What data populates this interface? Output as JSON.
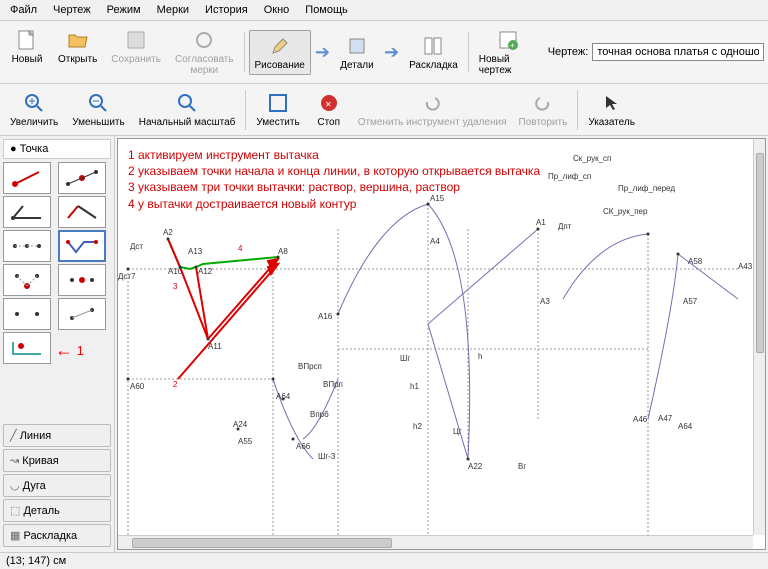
{
  "menu": [
    "Файл",
    "Чертеж",
    "Режим",
    "Мерки",
    "История",
    "Окно",
    "Помощь"
  ],
  "toolbar1": {
    "new": "Новый",
    "open": "Открыть",
    "save": "Сохранить",
    "sync": "Согласовать\nмерки",
    "drawing": "Рисование",
    "details": "Детали",
    "layout": "Раскладка",
    "newdraw": "Новый чертеж",
    "label": "Чертеж:",
    "value": "точная основа платья с одношовным рука"
  },
  "toolbar2": {
    "zoomin": "Увеличить",
    "zoomout": "Уменьшить",
    "zoom0": "Начальный масштаб",
    "fit": "Уместить",
    "stop": "Стоп",
    "undo": "Отменить инструмент удаления",
    "redo": "Повторить",
    "pointer": "Указатель"
  },
  "sidebar": {
    "title": "Точка",
    "cats": [
      "Линия",
      "Кривая",
      "Дуга",
      "Деталь",
      "Раскладка"
    ]
  },
  "arrow_label": "1",
  "instructions": [
    "1 активируем инструмент вытачка",
    "2 указываем точки начала и конца линии, в которую открывается вытачка",
    "3 указываем три точки вытачки: раствор, вершина, раствор",
    "4 у вытачки достраивается новый контур"
  ],
  "labels": {
    "dst": "Дст",
    "dst7": "Дст7",
    "a2": "А2",
    "a13": "А13",
    "a10": "А10",
    "a12": "А12",
    "a8": "А8",
    "a11": "А11",
    "a24": "А24",
    "a55": "А55",
    "a60": "А60",
    "a64": "А64",
    "a66": "А66",
    "vprb": "Впрб",
    "vprsp": "ВПрсп",
    "vprp": "ВПрп",
    "shr3": "Шг-3",
    "a15": "А15",
    "a16": "А16",
    "a4": "А4",
    "a1": "А1",
    "dpt": "Дпт",
    "a3": "А3",
    "a22": "А22",
    "shg": "Шг",
    "h1": "h1",
    "h2": "h2",
    "h": "h",
    "cg": "Цг",
    "vg": "Вг",
    "a46": "А46",
    "a47": "А47",
    "a64b": "А64",
    "a43": "А43",
    "a58": "А58",
    "a57": "А57",
    "pr_lif_sp": "Пр_лиф_сп",
    "sk_ruk_sp": "Ск_рук_сп",
    "pr_lif_pered": "Пр_лиф_перед",
    "sk_ruk_per": "СК_рук_пер",
    "m3": "3",
    "m4": "4",
    "m2": "2"
  },
  "status": "(13; 147) см"
}
